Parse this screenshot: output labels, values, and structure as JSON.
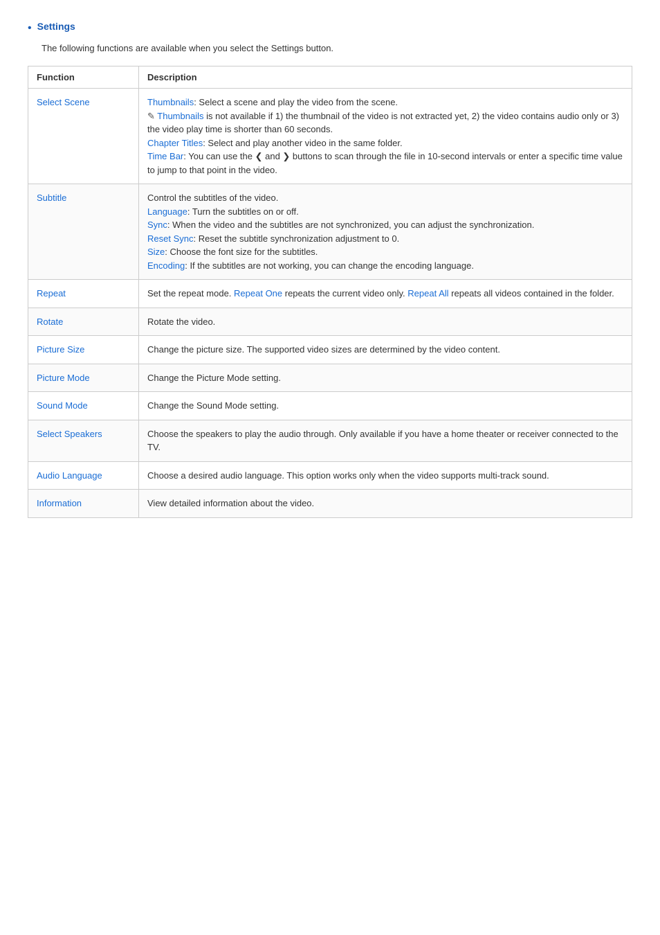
{
  "bullet": "•",
  "settings_link": "Settings",
  "intro_text": "The following functions are available when you select the Settings button.",
  "table": {
    "headers": [
      "Function",
      "Description"
    ],
    "rows": [
      {
        "function": "Select Scene",
        "description_parts": [
          {
            "type": "blue_label",
            "text": "Thumbnails"
          },
          {
            "type": "text",
            "text": ": Select a scene and play the video from the scene."
          },
          {
            "type": "newline"
          },
          {
            "type": "note_icon",
            "text": "✎ "
          },
          {
            "type": "blue_label2",
            "text": "Thumbnails"
          },
          {
            "type": "text",
            "text": " is not available if 1) the thumbnail of the video is not extracted yet, 2) the video contains audio only or 3) the video play time is shorter than 60 seconds."
          },
          {
            "type": "newline"
          },
          {
            "type": "blue_label",
            "text": "Chapter Titles"
          },
          {
            "type": "text",
            "text": ": Select and play another video in the same folder."
          },
          {
            "type": "newline"
          },
          {
            "type": "blue_label",
            "text": "Time Bar"
          },
          {
            "type": "text",
            "text": ": You can use the ❮ and ❯ buttons to scan through the file in 10-second intervals or enter a specific time value to jump to that point in the video."
          }
        ]
      },
      {
        "function": "Subtitle",
        "description_parts": [
          {
            "type": "text",
            "text": "Control the subtitles of the video."
          },
          {
            "type": "newline"
          },
          {
            "type": "blue_label",
            "text": "Language"
          },
          {
            "type": "text",
            "text": ": Turn the subtitles on or off."
          },
          {
            "type": "newline"
          },
          {
            "type": "blue_label",
            "text": "Sync"
          },
          {
            "type": "text",
            "text": ": When the video and the subtitles are not synchronized, you can adjust the synchronization."
          },
          {
            "type": "newline"
          },
          {
            "type": "blue_label",
            "text": "Reset Sync"
          },
          {
            "type": "text",
            "text": ": Reset the subtitle synchronization adjustment to 0."
          },
          {
            "type": "newline"
          },
          {
            "type": "blue_label",
            "text": "Size"
          },
          {
            "type": "text",
            "text": ": Choose the font size for the subtitles."
          },
          {
            "type": "newline"
          },
          {
            "type": "blue_label",
            "text": "Encoding"
          },
          {
            "type": "text",
            "text": ": If the subtitles are not working, you can change the encoding language."
          }
        ]
      },
      {
        "function": "Repeat",
        "description_parts": [
          {
            "type": "text",
            "text": "Set the repeat mode. "
          },
          {
            "type": "blue_label",
            "text": "Repeat One"
          },
          {
            "type": "text",
            "text": " repeats the current video only. "
          },
          {
            "type": "blue_label",
            "text": "Repeat All"
          },
          {
            "type": "text",
            "text": " repeats all videos contained in the folder."
          }
        ]
      },
      {
        "function": "Rotate",
        "description_parts": [
          {
            "type": "text",
            "text": "Rotate the video."
          }
        ]
      },
      {
        "function": "Picture Size",
        "description_parts": [
          {
            "type": "text",
            "text": "Change the picture size. The supported video sizes are determined by the video content."
          }
        ]
      },
      {
        "function": "Picture Mode",
        "description_parts": [
          {
            "type": "text",
            "text": "Change the Picture Mode setting."
          }
        ]
      },
      {
        "function": "Sound Mode",
        "description_parts": [
          {
            "type": "text",
            "text": "Change the Sound Mode setting."
          }
        ]
      },
      {
        "function": "Select Speakers",
        "description_parts": [
          {
            "type": "text",
            "text": "Choose the speakers to play the audio through. Only available if you have a home theater or receiver connected to the TV."
          }
        ]
      },
      {
        "function": "Audio Language",
        "description_parts": [
          {
            "type": "text",
            "text": "Choose a desired audio language. This option works only when the video supports multi-track sound."
          }
        ]
      },
      {
        "function": "Information",
        "description_parts": [
          {
            "type": "text",
            "text": "View detailed information about the video."
          }
        ]
      }
    ]
  }
}
